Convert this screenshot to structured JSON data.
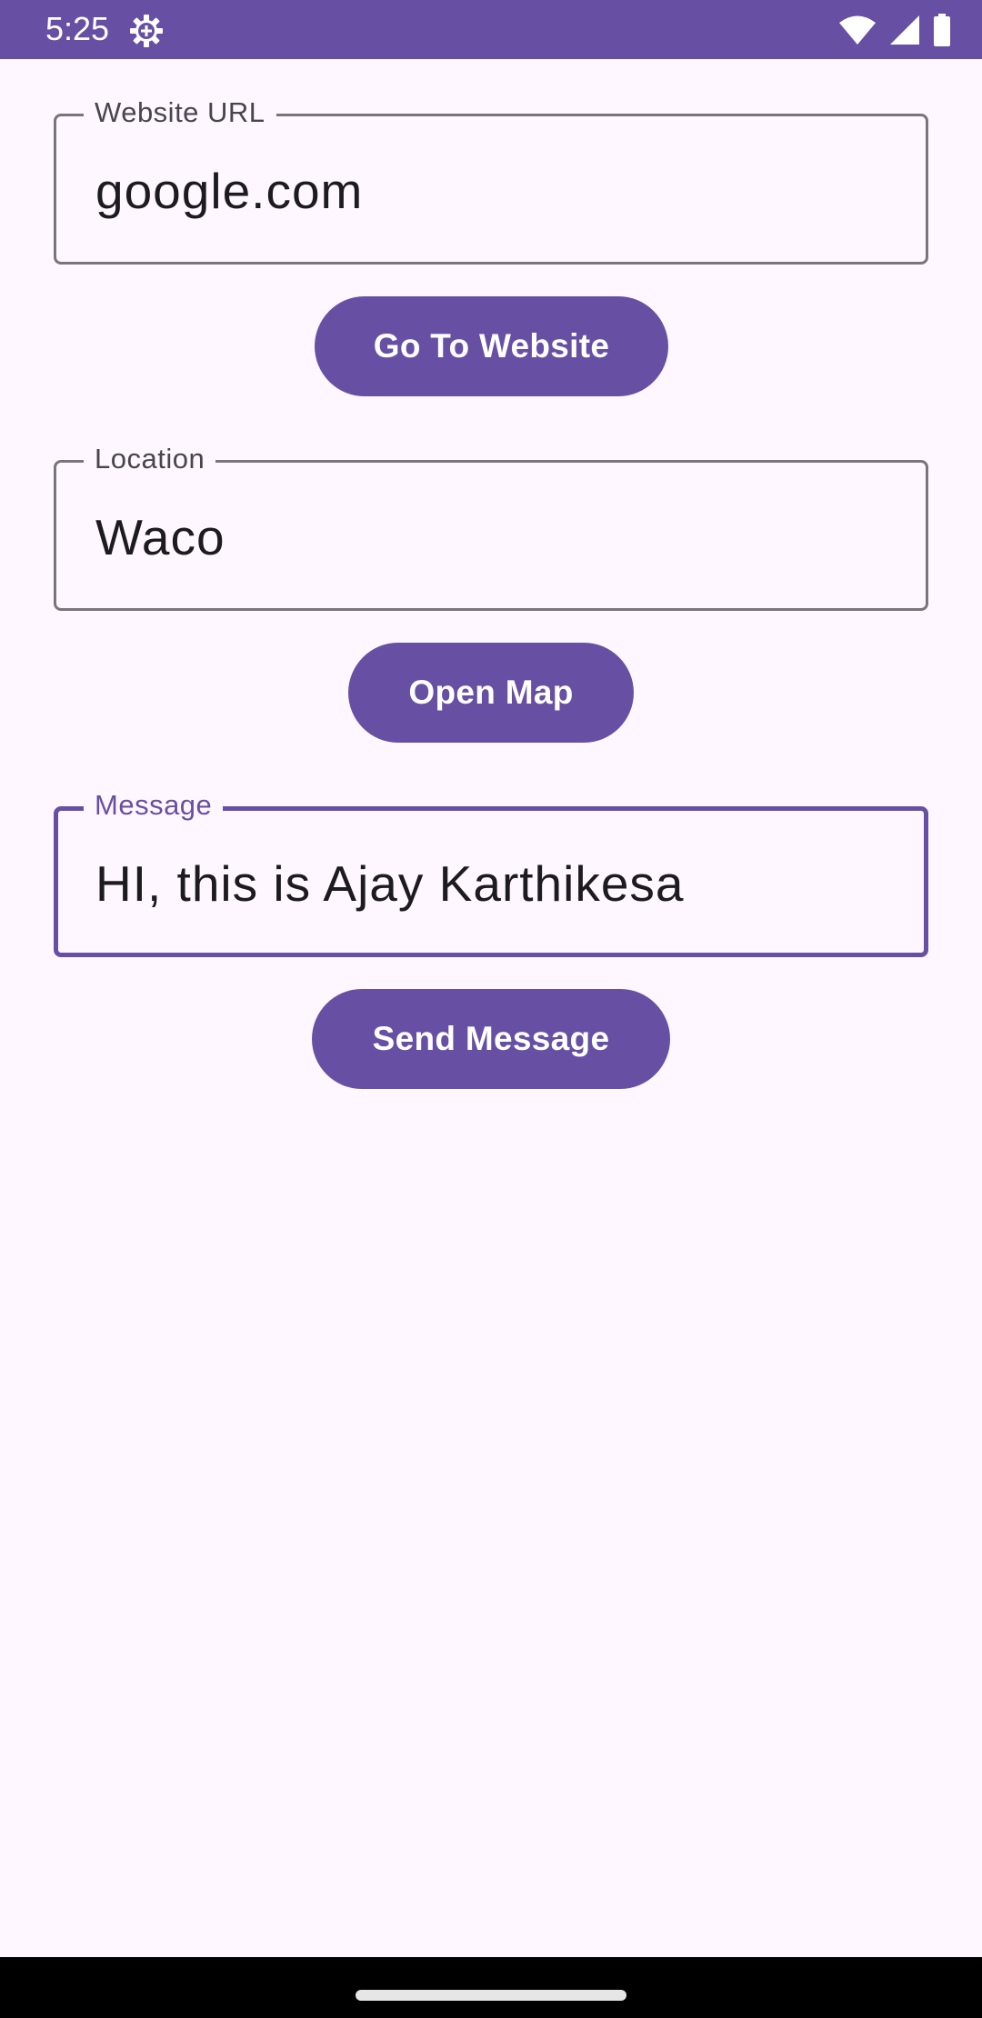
{
  "status_bar": {
    "time": "5:25",
    "icons": [
      "settings-gear-icon",
      "wifi-icon",
      "cellular-signal-icon",
      "battery-icon"
    ],
    "background_color": "#6750a4"
  },
  "form": {
    "website_field": {
      "label": "Website URL",
      "value": "google.com",
      "focused": false
    },
    "go_to_website_button": {
      "label": "Go To Website"
    },
    "location_field": {
      "label": "Location",
      "value": "Waco",
      "focused": false
    },
    "open_map_button": {
      "label": "Open Map"
    },
    "message_field": {
      "label": "Message",
      "value": "HI, this is Ajay Karthikesa",
      "focused": true
    },
    "send_message_button": {
      "label": "Send Message"
    }
  },
  "colors": {
    "primary": "#6750a4",
    "background": "#fef7ff",
    "outline": "#79747e",
    "on_surface": "#1d1b20"
  }
}
